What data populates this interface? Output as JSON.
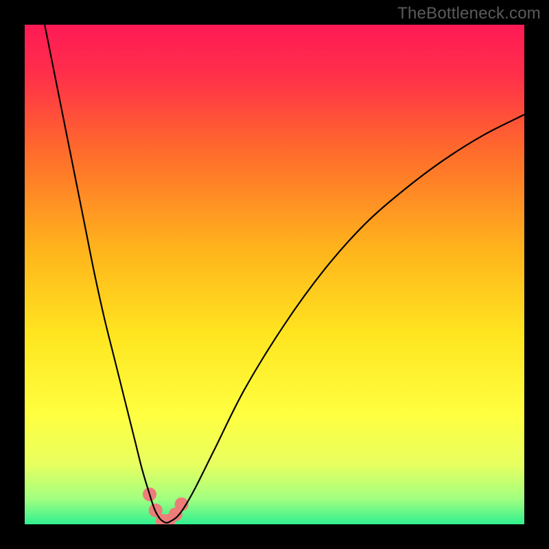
{
  "watermark": "TheBottleneck.com",
  "chart_data": {
    "type": "line",
    "title": "",
    "xlabel": "",
    "ylabel": "",
    "xlim": [
      0,
      100
    ],
    "ylim": [
      0,
      100
    ],
    "background": {
      "kind": "vertical-gradient",
      "stops": [
        {
          "pos": 0.0,
          "color": "#ff1a56"
        },
        {
          "pos": 0.1,
          "color": "#ff2f4a"
        },
        {
          "pos": 0.25,
          "color": "#ff6a2c"
        },
        {
          "pos": 0.45,
          "color": "#ffb41c"
        },
        {
          "pos": 0.62,
          "color": "#ffe520"
        },
        {
          "pos": 0.78,
          "color": "#ffff40"
        },
        {
          "pos": 0.88,
          "color": "#e8ff60"
        },
        {
          "pos": 0.95,
          "color": "#a0ff80"
        },
        {
          "pos": 1.0,
          "color": "#30f090"
        }
      ]
    },
    "series": [
      {
        "name": "curve",
        "color": "#000000",
        "width": 2.2,
        "x": [
          4,
          6,
          8,
          10,
          12,
          14,
          16,
          18,
          20,
          22,
          23.5,
          25,
          26,
          27,
          27.8,
          28.4,
          29,
          30.5,
          32,
          34,
          38,
          44,
          52,
          60,
          68,
          76,
          84,
          92,
          100
        ],
        "y": [
          100,
          90,
          80,
          70,
          60,
          50,
          41,
          33,
          25,
          17,
          11,
          6,
          3,
          1.2,
          0.5,
          0.3,
          0.5,
          1.5,
          3.5,
          7,
          15,
          27,
          40,
          51,
          60,
          67,
          73,
          78,
          82
        ]
      }
    ],
    "markers": {
      "color": "#ed7d78",
      "radius": 10,
      "points": [
        {
          "x": 25.0,
          "y": 6.0
        },
        {
          "x": 26.2,
          "y": 2.8
        },
        {
          "x": 27.6,
          "y": 0.7
        },
        {
          "x": 28.8,
          "y": 0.7
        },
        {
          "x": 30.2,
          "y": 2.0
        },
        {
          "x": 31.4,
          "y": 4.0
        }
      ]
    }
  }
}
